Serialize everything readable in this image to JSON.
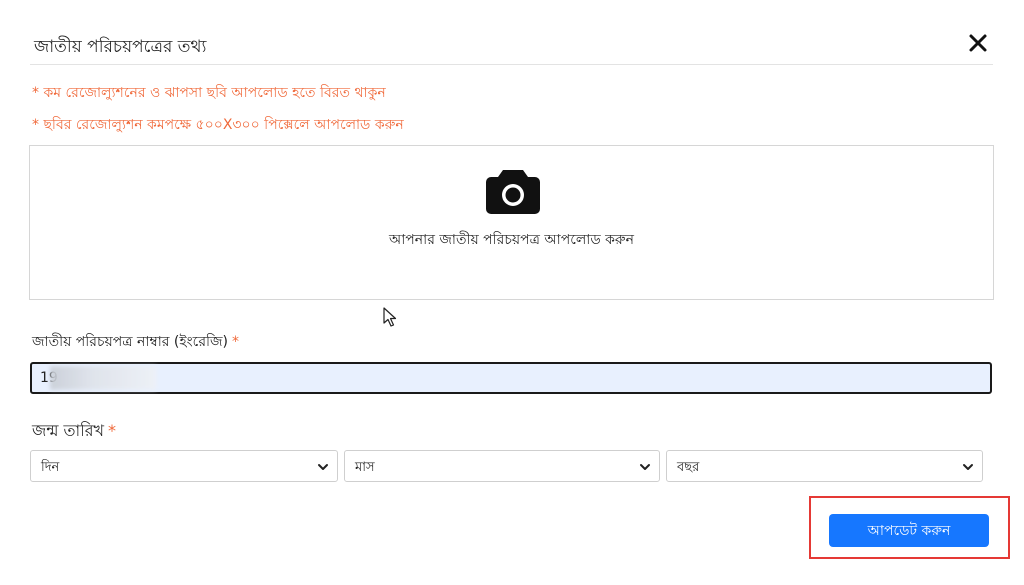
{
  "modal": {
    "title": "জাতীয় পরিচয়পত্রের তথ্য",
    "close_icon": "close-icon"
  },
  "notes": [
    "* কম রেজোল্যুশনের ও ঝাপসা ছবি আপলোড হতে বিরত থাকুন",
    "* ছবির রেজোল্যুশন কমপক্ষে ৫০০X৩০০ পিক্সেলে আপলোড করুন"
  ],
  "upload": {
    "icon": "camera-icon",
    "text": "আপনার জাতীয় পরিচয়পত্র আপলোড করুন"
  },
  "nid": {
    "label": "জাতীয় পরিচয়পত্র নাম্বার (ইংরেজি)",
    "required_mark": "*",
    "value": "19"
  },
  "dob": {
    "label": "জন্ম তারিখ",
    "required_mark": "*",
    "day": "দিন",
    "month": "মাস",
    "year": "বছর"
  },
  "update_button": "আপডেট করুন",
  "colors": {
    "accent": "#1677ff",
    "warning": "#f0693a",
    "highlight": "#e53935"
  }
}
